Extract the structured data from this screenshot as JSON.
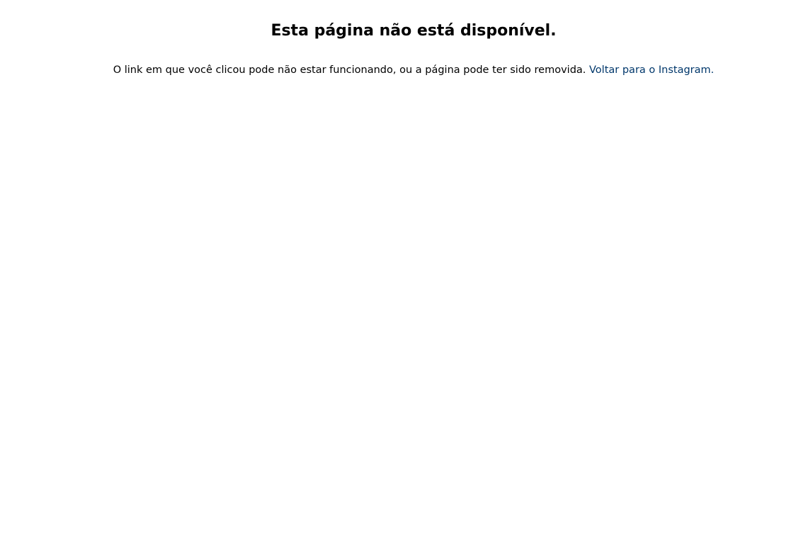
{
  "error": {
    "title": "Esta página não está disponível.",
    "message": "O link em que você clicou pode não estar funcionando, ou a página pode ter sido removida.",
    "link_label": "Voltar para o Instagram.",
    "link_color": "#00376b"
  }
}
